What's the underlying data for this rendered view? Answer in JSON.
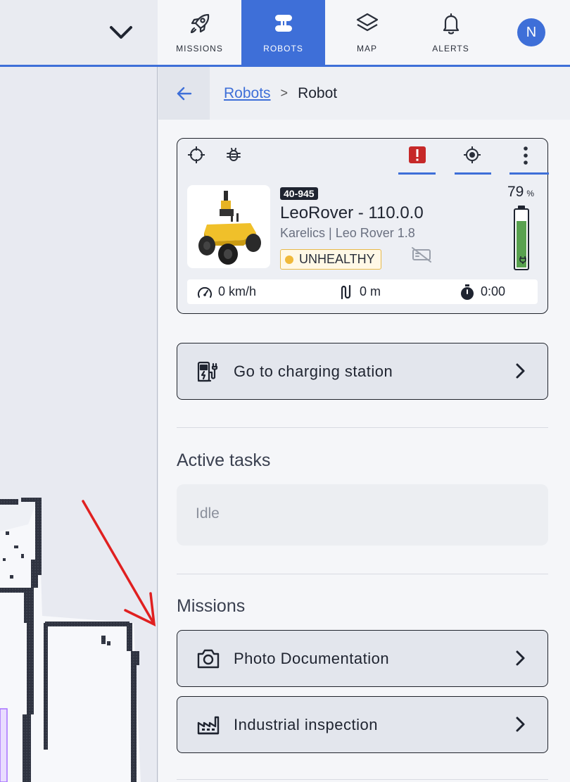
{
  "nav": {
    "tabs": [
      {
        "label": "MISSIONS",
        "icon": "rocket-icon",
        "active": false
      },
      {
        "label": "ROBOTS",
        "icon": "robot-icon",
        "active": true
      },
      {
        "label": "MAP",
        "icon": "layers-icon",
        "active": false
      },
      {
        "label": "ALERTS",
        "icon": "bell-icon",
        "active": false
      }
    ],
    "avatar_initial": "N"
  },
  "breadcrumb": {
    "parent": "Robots",
    "separator": ">",
    "current": "Robot"
  },
  "robot": {
    "id": "40-945",
    "name": "LeoRover - 110.0.0",
    "model": "Karelics | Leo Rover 1.8",
    "health": "UNHEALTHY",
    "battery_percent": "79",
    "battery_unit": "%",
    "battery_level": 0.79,
    "speed": "0 km/h",
    "distance": "0 m",
    "duration": "0:00"
  },
  "actions": {
    "charging_label": "Go to charging station"
  },
  "active_tasks": {
    "title": "Active tasks",
    "status": "Idle"
  },
  "missions": {
    "title": "Missions",
    "items": [
      {
        "label": "Photo Documentation",
        "icon": "camera-icon"
      },
      {
        "label": "Industrial inspection",
        "icon": "factory-icon"
      }
    ]
  },
  "colors": {
    "accent": "#3e6fd8",
    "alert": "#c62828",
    "health_warning": "#f0b93a",
    "battery": "#59a14f",
    "annotation_arrow": "#e02020"
  }
}
